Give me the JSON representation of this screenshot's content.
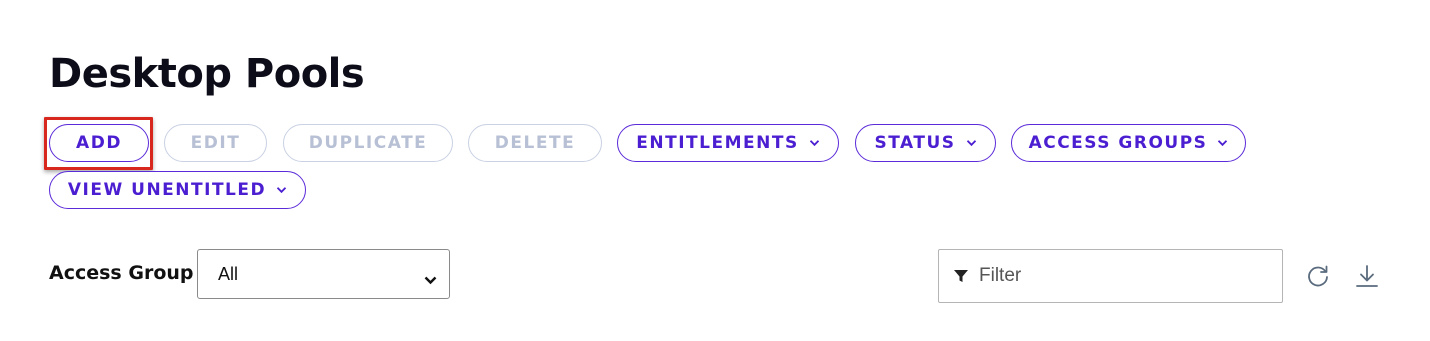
{
  "page": {
    "title": "Desktop Pools"
  },
  "toolbar": {
    "add": "ADD",
    "edit": "EDIT",
    "duplicate": "DUPLICATE",
    "delete": "DELETE",
    "entitlements": "ENTITLEMENTS",
    "status": "STATUS",
    "access_groups": "ACCESS GROUPS",
    "view_unentitled": "VIEW UNENTITLED"
  },
  "access_group": {
    "label": "Access Group",
    "selected": "All"
  },
  "filter": {
    "placeholder": "Filter",
    "value": ""
  },
  "icons": {
    "dropdown": "chevron-down-icon",
    "filter": "filter-funnel-icon",
    "refresh": "refresh-icon",
    "download": "download-icon"
  },
  "colors": {
    "accent": "#4b1fd1",
    "disabled": "#b7c0d4",
    "highlight": "#d8281d"
  }
}
